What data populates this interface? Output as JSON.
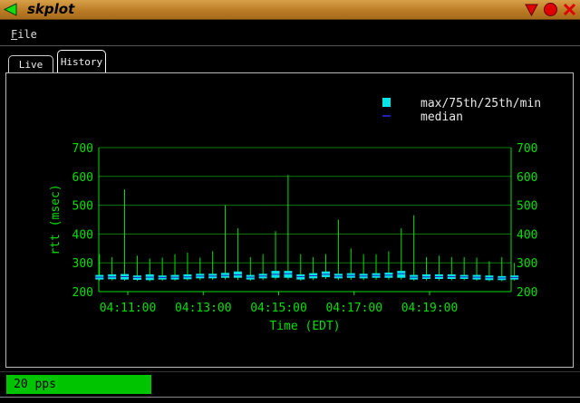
{
  "window": {
    "title": "skplot"
  },
  "menu": {
    "file_label": "File",
    "file_mnemonic": "F",
    "file_rest": "ile"
  },
  "tabs": [
    {
      "label": "Live"
    },
    {
      "label": "History"
    }
  ],
  "status": {
    "pps": "20 pps"
  },
  "colors": {
    "axis": "#00e000",
    "box": "#00e5e5",
    "median": "#2020c0",
    "title_bar": "#c48a34",
    "status_green": "#00c400"
  },
  "icons": {
    "back": "triangle-left-green",
    "minimize": "triangle-down-red",
    "maximize": "circle-red",
    "close": "x-red"
  },
  "chart_data": {
    "type": "box",
    "xlabel": "Time (EDT)",
    "ylabel": "rtt (msec)",
    "ylim": [
      200,
      700
    ],
    "yticks": [
      200,
      300,
      400,
      500,
      600,
      700
    ],
    "xticks": [
      "04:11:00",
      "04:13:00",
      "04:15:00",
      "04:17:00",
      "04:19:00"
    ],
    "legend": {
      "placement": "top-right",
      "box_label": "max/75th/25th/min",
      "median_label": "median"
    },
    "grid": true,
    "x_start": "04:10:15",
    "interval_seconds": 20,
    "series": [
      {
        "max": 330,
        "q3": 258,
        "q1": 242,
        "min": 238,
        "median": 250
      },
      {
        "max": 320,
        "q3": 260,
        "q1": 243,
        "min": 239,
        "median": 251
      },
      {
        "max": 555,
        "q3": 261,
        "q1": 242,
        "min": 238,
        "median": 252
      },
      {
        "max": 325,
        "q3": 256,
        "q1": 241,
        "min": 237,
        "median": 249
      },
      {
        "max": 315,
        "q3": 260,
        "q1": 240,
        "min": 236,
        "median": 250
      },
      {
        "max": 318,
        "q3": 256,
        "q1": 242,
        "min": 238,
        "median": 249
      },
      {
        "max": 330,
        "q3": 258,
        "q1": 242,
        "min": 238,
        "median": 250
      },
      {
        "max": 335,
        "q3": 260,
        "q1": 243,
        "min": 239,
        "median": 251
      },
      {
        "max": 318,
        "q3": 262,
        "q1": 246,
        "min": 240,
        "median": 254
      },
      {
        "max": 340,
        "q3": 262,
        "q1": 246,
        "min": 241,
        "median": 254
      },
      {
        "max": 500,
        "q3": 265,
        "q1": 248,
        "min": 242,
        "median": 256
      },
      {
        "max": 420,
        "q3": 270,
        "q1": 248,
        "min": 240,
        "median": 258
      },
      {
        "max": 320,
        "q3": 258,
        "q1": 242,
        "min": 238,
        "median": 250
      },
      {
        "max": 330,
        "q3": 262,
        "q1": 246,
        "min": 240,
        "median": 254
      },
      {
        "max": 410,
        "q3": 272,
        "q1": 248,
        "min": 242,
        "median": 260
      },
      {
        "max": 605,
        "q3": 272,
        "q1": 248,
        "min": 242,
        "median": 262
      },
      {
        "max": 330,
        "q3": 260,
        "q1": 242,
        "min": 238,
        "median": 252
      },
      {
        "max": 320,
        "q3": 264,
        "q1": 246,
        "min": 240,
        "median": 255
      },
      {
        "max": 330,
        "q3": 270,
        "q1": 250,
        "min": 244,
        "median": 260
      },
      {
        "max": 450,
        "q3": 262,
        "q1": 246,
        "min": 240,
        "median": 254
      },
      {
        "max": 350,
        "q3": 264,
        "q1": 248,
        "min": 241,
        "median": 256
      },
      {
        "max": 330,
        "q3": 262,
        "q1": 246,
        "min": 240,
        "median": 254
      },
      {
        "max": 330,
        "q3": 264,
        "q1": 248,
        "min": 241,
        "median": 256
      },
      {
        "max": 340,
        "q3": 266,
        "q1": 248,
        "min": 242,
        "median": 257
      },
      {
        "max": 420,
        "q3": 272,
        "q1": 248,
        "min": 242,
        "median": 262
      },
      {
        "max": 465,
        "q3": 258,
        "q1": 242,
        "min": 238,
        "median": 250
      },
      {
        "max": 320,
        "q3": 260,
        "q1": 244,
        "min": 239,
        "median": 251
      },
      {
        "max": 325,
        "q3": 260,
        "q1": 244,
        "min": 239,
        "median": 252
      },
      {
        "max": 320,
        "q3": 260,
        "q1": 244,
        "min": 239,
        "median": 252
      },
      {
        "max": 320,
        "q3": 258,
        "q1": 244,
        "min": 239,
        "median": 251
      },
      {
        "max": 318,
        "q3": 258,
        "q1": 242,
        "min": 238,
        "median": 250
      },
      {
        "max": 305,
        "q3": 256,
        "q1": 240,
        "min": 236,
        "median": 248
      },
      {
        "max": 320,
        "q3": 254,
        "q1": 240,
        "min": 236,
        "median": 247
      },
      {
        "max": 300,
        "q3": 256,
        "q1": 242,
        "min": 238,
        "median": 249
      }
    ]
  }
}
